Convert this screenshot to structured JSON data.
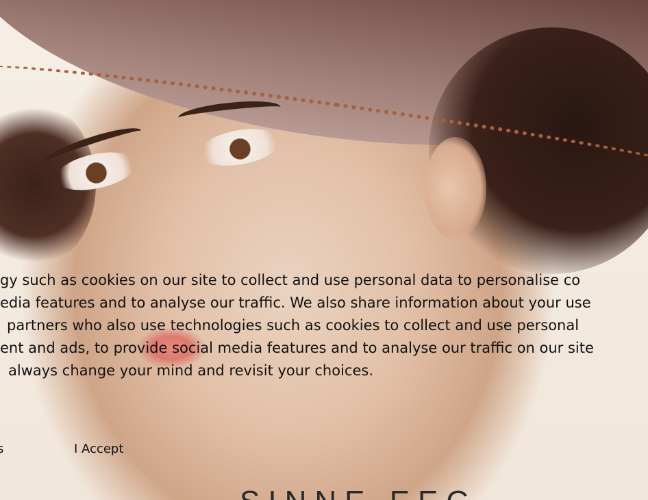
{
  "cookie_banner": {
    "lines": [
      "gy such as cookies on our site to collect and use personal data to personalise co",
      "edia features and to analyse our traffic. We also share information about your use",
      "partners who also use technologies such as cookies to collect and use personal",
      "ent and ads, to provide social media features and to analyse our traffic on our site",
      "always change your mind and revisit your choices."
    ],
    "settings_label": "s",
    "accept_label": "I Accept"
  },
  "cover": {
    "title_fragment": "SINNE EEG"
  }
}
